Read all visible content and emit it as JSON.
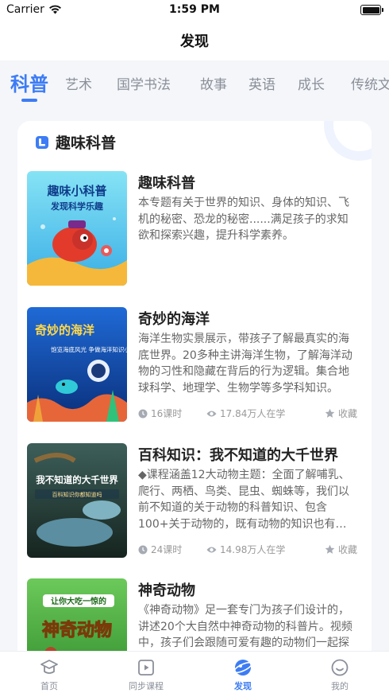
{
  "status_bar": {
    "carrier": "Carrier",
    "time": "1:59 PM"
  },
  "nav": {
    "title": "发现"
  },
  "category_tabs": [
    {
      "label": "科普",
      "active": true
    },
    {
      "label": "艺术"
    },
    {
      "label": "国学书法"
    },
    {
      "label": "故事"
    },
    {
      "label": "英语"
    },
    {
      "label": "成长"
    },
    {
      "label": "传统文"
    }
  ],
  "section": {
    "title": "趣味科普",
    "icon": "book-icon"
  },
  "courses": [
    {
      "title": "趣味科普",
      "description": "本专题有关于世界的知识、身体的知识、飞机的秘密、恐龙的秘密......满足孩子的求知欲和探索兴趣，提升科学素养。",
      "thumb": {
        "title": "趣味小科普",
        "subtitle": "发现科学乐趣",
        "bg_top": "#7ee0f4",
        "bg_bottom": "#3bb3e6"
      }
    },
    {
      "title": "奇妙的海洋",
      "description": "海洋生物实景展示，带孩子了解最真实的海底世界。20多种主讲海洋生物，了解海洋动物的习性和隐藏在背后的行为逻辑。集合地球科学、地理学、生物学等多学科知识。",
      "lessons": "16课时",
      "learners": "17.84万人在学",
      "favorite": "收藏",
      "thumb": {
        "title": "奇妙的海洋",
        "subtitle": "饱览海底风光 争做海洋知识小博士",
        "bg_top": "#1a5fc9",
        "bg_bottom": "#0a2f7a"
      }
    },
    {
      "title": "百科知识：我不知道的大千世界",
      "description": "◆课程涵盖12大动物主题：全面了解哺乳、爬行、两栖、鸟类、昆虫、蜘蛛等，我们以前不知道的关于动物的科普知识、包含100+关于动物的，既有动物的知识也有有趣的故事。",
      "lessons": "24课时",
      "learners": "14.98万人在学",
      "favorite": "收藏",
      "thumb": {
        "title": "我不知道的大千世界",
        "subtitle": "百科知识你都知道吗",
        "bg_top": "#2f4d4a",
        "bg_bottom": "#1a2b2a"
      }
    },
    {
      "title": "神奇动物",
      "description": "《神奇动物》足一套专门为孩子们设计的，讲述20个大自然中神奇动物的科普片。视频中，孩子们会跟随可爱有趣的动物们一起探索大自然。",
      "thumb": {
        "title": "神奇动物",
        "subtitle": "让你大吃一惊的",
        "bg_top": "#5bbf4a",
        "bg_bottom": "#2f8a2a"
      }
    }
  ],
  "tab_bar": [
    {
      "label": "首页",
      "icon": "graduation-cap-icon"
    },
    {
      "label": "同步课程",
      "icon": "video-play-icon"
    },
    {
      "label": "发现",
      "icon": "discover-planet-icon",
      "active": true
    },
    {
      "label": "我的",
      "icon": "smiley-face-icon"
    }
  ],
  "colors": {
    "accent": "#3d7cf4",
    "text_secondary": "#666666",
    "meta": "#999999",
    "background": "#f4f6fa"
  }
}
